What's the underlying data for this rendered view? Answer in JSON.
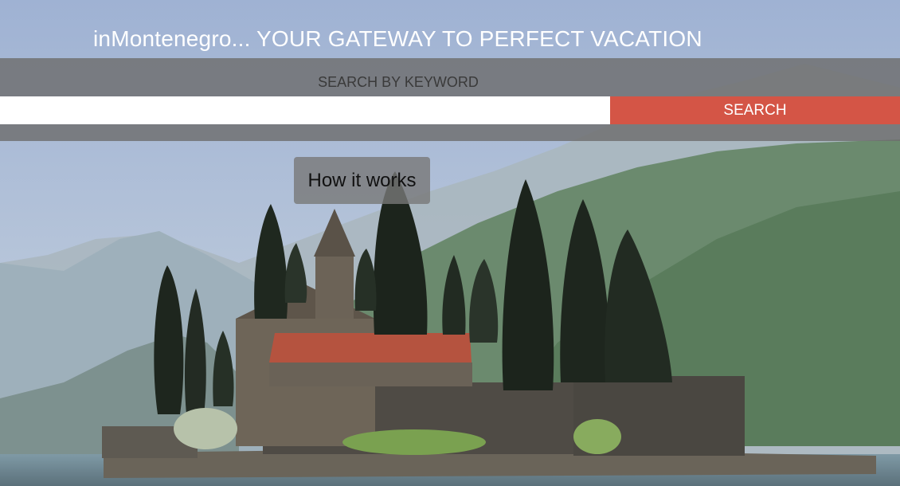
{
  "header": {
    "title": "inMontenegro... YOUR GATEWAY TO PERFECT VACATION"
  },
  "search": {
    "label": "SEARCH BY KEYWORD",
    "input_value": "",
    "placeholder": "",
    "button_label": "SEARCH"
  },
  "cta": {
    "how_it_works_label": "How it works"
  },
  "colors": {
    "search_button": "#d45546",
    "search_band": "#6e6e6e",
    "sky": "#8fa6c4"
  }
}
